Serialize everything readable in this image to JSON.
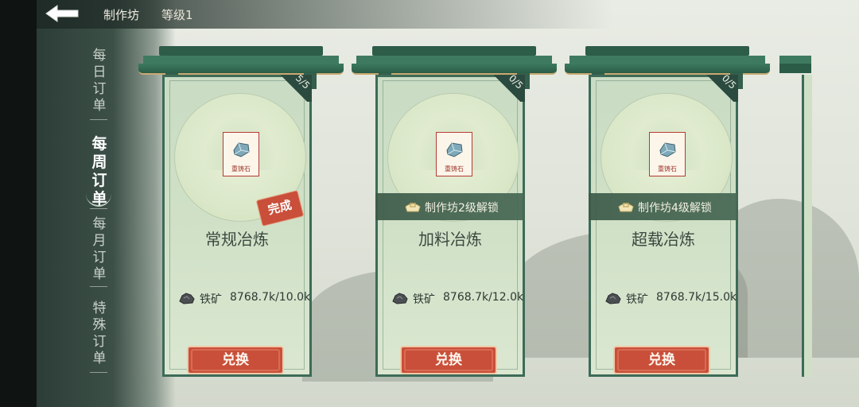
{
  "header": {
    "title": "制作坊",
    "level": "等级1"
  },
  "sidebar": {
    "tabs": [
      {
        "label": "每\n日\n订\n单",
        "active": false
      },
      {
        "label": "每\n周\n订\n单",
        "active": true
      },
      {
        "label": "每\n月\n订\n单",
        "active": false
      },
      {
        "label": "特\n殊\n订\n单",
        "active": false
      }
    ]
  },
  "cards": [
    {
      "title": "常规冶炼",
      "count": "5/5",
      "item_name": "重铸石",
      "status_stamp": "完成",
      "lock_text": "",
      "cost_label": "铁矿",
      "cost_value": "8768.7k/10.0k",
      "button": "兑换"
    },
    {
      "title": "加料冶炼",
      "count": "0/5",
      "item_name": "重铸石",
      "status_stamp": "",
      "lock_text": "制作坊2级解锁",
      "cost_label": "铁矿",
      "cost_value": "8768.7k/12.0k",
      "button": "兑换"
    },
    {
      "title": "超载冶炼",
      "count": "0/5",
      "item_name": "重铸石",
      "status_stamp": "",
      "lock_text": "制作坊4级解锁",
      "cost_label": "铁矿",
      "cost_value": "8768.7k/15.0k",
      "button": "兑换"
    }
  ],
  "colors": {
    "card_green": "#3d6b58",
    "button_red": "#c94f3a",
    "stamp_red": "#c94f3a"
  }
}
